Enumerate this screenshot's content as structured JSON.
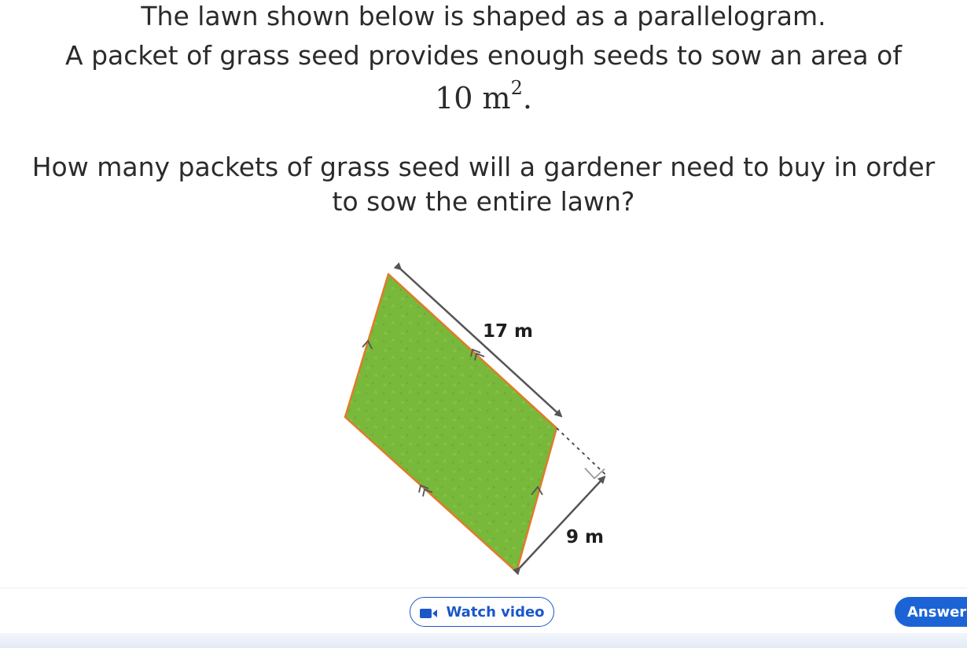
{
  "question": {
    "line1": "The lawn shown below is shaped as a parallelogram.",
    "line2": "A packet of grass seed provides enough seeds to sow an area of",
    "area_value": "10",
    "area_unit": "m",
    "area_exponent": "2",
    "area_punct": ".",
    "line4": "How many packets of grass seed will a gardener need to buy in order",
    "line5": "to sow the entire lawn?"
  },
  "diagram": {
    "side_label": "17 m",
    "height_label": "9 m",
    "fill_color": "#78b83a",
    "edge_color": "#e07b2a",
    "arrow_color": "#555555"
  },
  "buttons": {
    "watch_label": "Watch video",
    "watch_icon": "video-camera-icon",
    "answer_label": "Answer"
  }
}
